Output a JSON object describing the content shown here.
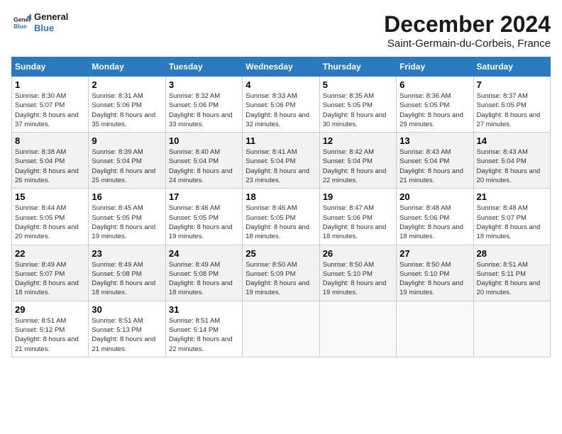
{
  "logo": {
    "line1": "General",
    "line2": "Blue"
  },
  "title": "December 2024",
  "location": "Saint-Germain-du-Corbeis, France",
  "days_of_week": [
    "Sunday",
    "Monday",
    "Tuesday",
    "Wednesday",
    "Thursday",
    "Friday",
    "Saturday"
  ],
  "weeks": [
    [
      {
        "day": "1",
        "sunrise": "8:30 AM",
        "sunset": "5:07 PM",
        "daylight": "8 hours and 37 minutes."
      },
      {
        "day": "2",
        "sunrise": "8:31 AM",
        "sunset": "5:06 PM",
        "daylight": "8 hours and 35 minutes."
      },
      {
        "day": "3",
        "sunrise": "8:32 AM",
        "sunset": "5:06 PM",
        "daylight": "8 hours and 33 minutes."
      },
      {
        "day": "4",
        "sunrise": "8:33 AM",
        "sunset": "5:06 PM",
        "daylight": "8 hours and 32 minutes."
      },
      {
        "day": "5",
        "sunrise": "8:35 AM",
        "sunset": "5:05 PM",
        "daylight": "8 hours and 30 minutes."
      },
      {
        "day": "6",
        "sunrise": "8:36 AM",
        "sunset": "5:05 PM",
        "daylight": "8 hours and 29 minutes."
      },
      {
        "day": "7",
        "sunrise": "8:37 AM",
        "sunset": "5:05 PM",
        "daylight": "8 hours and 27 minutes."
      }
    ],
    [
      {
        "day": "8",
        "sunrise": "8:38 AM",
        "sunset": "5:04 PM",
        "daylight": "8 hours and 26 minutes."
      },
      {
        "day": "9",
        "sunrise": "8:39 AM",
        "sunset": "5:04 PM",
        "daylight": "8 hours and 25 minutes."
      },
      {
        "day": "10",
        "sunrise": "8:40 AM",
        "sunset": "5:04 PM",
        "daylight": "8 hours and 24 minutes."
      },
      {
        "day": "11",
        "sunrise": "8:41 AM",
        "sunset": "5:04 PM",
        "daylight": "8 hours and 23 minutes."
      },
      {
        "day": "12",
        "sunrise": "8:42 AM",
        "sunset": "5:04 PM",
        "daylight": "8 hours and 22 minutes."
      },
      {
        "day": "13",
        "sunrise": "8:43 AM",
        "sunset": "5:04 PM",
        "daylight": "8 hours and 21 minutes."
      },
      {
        "day": "14",
        "sunrise": "8:43 AM",
        "sunset": "5:04 PM",
        "daylight": "8 hours and 20 minutes."
      }
    ],
    [
      {
        "day": "15",
        "sunrise": "8:44 AM",
        "sunset": "5:05 PM",
        "daylight": "8 hours and 20 minutes."
      },
      {
        "day": "16",
        "sunrise": "8:45 AM",
        "sunset": "5:05 PM",
        "daylight": "8 hours and 19 minutes."
      },
      {
        "day": "17",
        "sunrise": "8:46 AM",
        "sunset": "5:05 PM",
        "daylight": "8 hours and 19 minutes."
      },
      {
        "day": "18",
        "sunrise": "8:46 AM",
        "sunset": "5:05 PM",
        "daylight": "8 hours and 18 minutes."
      },
      {
        "day": "19",
        "sunrise": "8:47 AM",
        "sunset": "5:06 PM",
        "daylight": "8 hours and 18 minutes."
      },
      {
        "day": "20",
        "sunrise": "8:48 AM",
        "sunset": "5:06 PM",
        "daylight": "8 hours and 18 minutes."
      },
      {
        "day": "21",
        "sunrise": "8:48 AM",
        "sunset": "5:07 PM",
        "daylight": "8 hours and 18 minutes."
      }
    ],
    [
      {
        "day": "22",
        "sunrise": "8:49 AM",
        "sunset": "5:07 PM",
        "daylight": "8 hours and 18 minutes."
      },
      {
        "day": "23",
        "sunrise": "8:49 AM",
        "sunset": "5:08 PM",
        "daylight": "8 hours and 18 minutes."
      },
      {
        "day": "24",
        "sunrise": "8:49 AM",
        "sunset": "5:08 PM",
        "daylight": "8 hours and 18 minutes."
      },
      {
        "day": "25",
        "sunrise": "8:50 AM",
        "sunset": "5:09 PM",
        "daylight": "8 hours and 19 minutes."
      },
      {
        "day": "26",
        "sunrise": "8:50 AM",
        "sunset": "5:10 PM",
        "daylight": "8 hours and 19 minutes."
      },
      {
        "day": "27",
        "sunrise": "8:50 AM",
        "sunset": "5:10 PM",
        "daylight": "8 hours and 19 minutes."
      },
      {
        "day": "28",
        "sunrise": "8:51 AM",
        "sunset": "5:11 PM",
        "daylight": "8 hours and 20 minutes."
      }
    ],
    [
      {
        "day": "29",
        "sunrise": "8:51 AM",
        "sunset": "5:12 PM",
        "daylight": "8 hours and 21 minutes."
      },
      {
        "day": "30",
        "sunrise": "8:51 AM",
        "sunset": "5:13 PM",
        "daylight": "8 hours and 21 minutes."
      },
      {
        "day": "31",
        "sunrise": "8:51 AM",
        "sunset": "5:14 PM",
        "daylight": "8 hours and 22 minutes."
      },
      null,
      null,
      null,
      null
    ]
  ],
  "labels": {
    "sunrise": "Sunrise:",
    "sunset": "Sunset:",
    "daylight": "Daylight:"
  }
}
